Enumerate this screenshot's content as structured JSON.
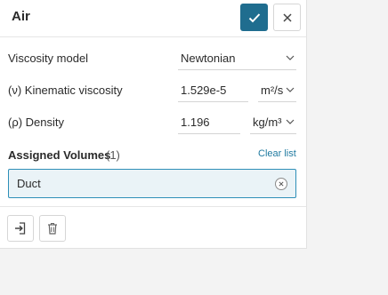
{
  "header": {
    "title": "Air",
    "confirm_icon": "check-icon",
    "close_icon": "close-icon"
  },
  "fields": {
    "viscosity_model": {
      "label": "Viscosity model",
      "value": "Newtonian"
    },
    "kinematic_viscosity": {
      "label": "(ν) Kinematic viscosity",
      "value": "1.529e-5",
      "unit": "m²/s"
    },
    "density": {
      "label": "(ρ) Density",
      "value": "1.196",
      "unit": "kg/m³"
    }
  },
  "assigned_volumes": {
    "title": "Assigned Volumes",
    "count": "(1)",
    "clear_label": "Clear list",
    "items": [
      {
        "label": "Duct"
      }
    ]
  },
  "footer": {
    "assign_icon": "import-icon",
    "delete_icon": "trash-icon"
  },
  "colors": {
    "accent": "#1f6d8f",
    "link": "#1f7aa0",
    "chip_border": "#2e8fb8",
    "chip_bg": "#eaf3f7"
  }
}
